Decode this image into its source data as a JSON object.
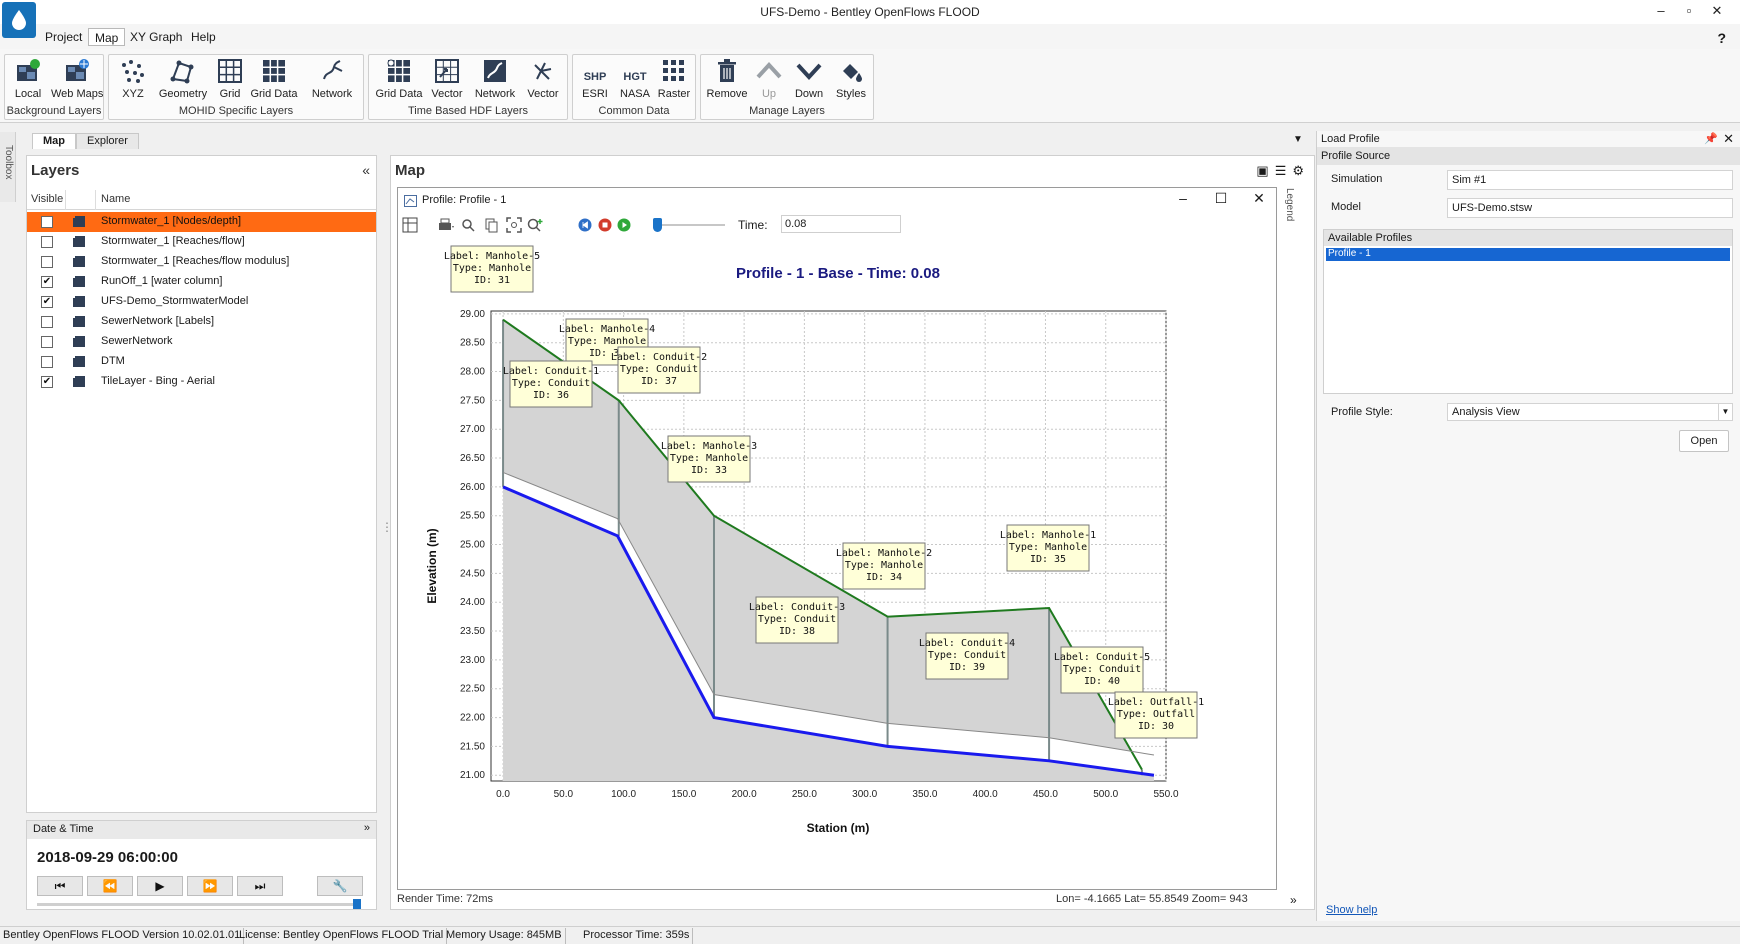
{
  "window": {
    "title": "UFS-Demo - Bentley OpenFlows FLOOD",
    "minimize": "–",
    "maximize": "▫",
    "close": "✕"
  },
  "menu": {
    "items": [
      "Project",
      "Map",
      "XY Graph",
      "Help"
    ],
    "help_icon": "?"
  },
  "ribbon": {
    "groups": [
      {
        "label": "Background Layers",
        "buttons": [
          {
            "label": "Local",
            "icon": "local-map-icon"
          },
          {
            "label": "Web Maps",
            "icon": "web-maps-icon"
          }
        ]
      },
      {
        "label": "MOHID Specific Layers",
        "buttons": [
          {
            "label": "XYZ",
            "icon": "xyz-points-icon"
          },
          {
            "label": "Geometry",
            "icon": "geometry-icon"
          },
          {
            "label": "Grid",
            "icon": "grid-icon"
          },
          {
            "label": "Grid Data",
            "icon": "grid-data-icon"
          },
          {
            "label": "Network",
            "icon": "network-icon"
          }
        ]
      },
      {
        "label": "Time Based HDF Layers",
        "buttons": [
          {
            "label": "Grid Data",
            "icon": "hdf-grid-data-icon"
          },
          {
            "label": "Vector",
            "icon": "vector-grid-icon"
          },
          {
            "label": "Network",
            "icon": "hdf-network-icon"
          },
          {
            "label": "Vector",
            "icon": "vector-arrows-icon"
          }
        ]
      },
      {
        "label": "Common Data",
        "buttons": [
          {
            "label": "ESRI",
            "icon": "esri-shp-icon",
            "glyph": "SHP"
          },
          {
            "label": "NASA",
            "icon": "nasa-hgt-icon",
            "glyph": "HGT"
          },
          {
            "label": "Raster",
            "icon": "raster-icon"
          }
        ]
      },
      {
        "label": "Manage Layers",
        "buttons": [
          {
            "label": "Remove",
            "icon": "trash-icon"
          },
          {
            "label": "Up",
            "icon": "up-arrow-icon"
          },
          {
            "label": "Down",
            "icon": "down-arrow-icon"
          },
          {
            "label": "Styles",
            "icon": "styles-icon"
          }
        ]
      }
    ]
  },
  "toolbox": {
    "label": "Toolbox"
  },
  "doc_tabs": [
    "Map",
    "Explorer"
  ],
  "layers": {
    "title": "Layers",
    "collapse": "«",
    "columns": {
      "visible": "Visible",
      "name": "Name"
    },
    "rows": [
      {
        "name": "Stormwater_1 [Nodes/depth]",
        "checked": false,
        "selected": true
      },
      {
        "name": "Stormwater_1 [Reaches/flow]",
        "checked": false,
        "selected": false
      },
      {
        "name": "Stormwater_1 [Reaches/flow modulus]",
        "checked": false,
        "selected": false
      },
      {
        "name": "RunOff_1 [water column]",
        "checked": true,
        "selected": false
      },
      {
        "name": "UFS-Demo_StormwaterModel",
        "checked": true,
        "selected": false
      },
      {
        "name": "SewerNetwork [Labels]",
        "checked": false,
        "selected": false
      },
      {
        "name": "SewerNetwork",
        "checked": false,
        "selected": false
      },
      {
        "name": "DTM",
        "checked": false,
        "selected": false
      },
      {
        "name": "TileLayer - Bing - Aerial",
        "checked": true,
        "selected": false
      }
    ]
  },
  "datetime": {
    "title": "Date & Time",
    "collapse": "»",
    "value": "2018-09-29 06:00:00",
    "controls": [
      "⏮",
      "⏪",
      "▶",
      "⏩",
      "⏭",
      "🔧"
    ],
    "position": 1.0
  },
  "map": {
    "title": "Map",
    "render_time": "Render Time: 72ms",
    "coords": "Lon= -4.1665   Lat= 55.8549   Zoom= 943",
    "legend": "Legend",
    "collapse": "»"
  },
  "profile_window": {
    "title": "Profile: Profile - 1",
    "time_label": "Time:",
    "time_value": "0.08",
    "time_position": 0.0
  },
  "chart_data": {
    "type": "line",
    "title": "Profile - 1 - Base - Time: 0.08",
    "xlabel": "Station (m)",
    "ylabel": "Elevation (m)",
    "xlim": [
      -10,
      550
    ],
    "ylim": [
      20.9,
      29.05
    ],
    "xticks": [
      "0.0",
      "50.0",
      "100.0",
      "150.0",
      "200.0",
      "250.0",
      "300.0",
      "350.0",
      "400.0",
      "450.0",
      "500.0",
      "550.0"
    ],
    "yticks": [
      "21.00",
      "21.50",
      "22.00",
      "22.50",
      "23.00",
      "23.50",
      "24.00",
      "24.50",
      "25.00",
      "25.50",
      "26.00",
      "26.50",
      "27.00",
      "27.50",
      "28.00",
      "28.50",
      "29.00"
    ],
    "grid": true,
    "series": [
      {
        "role": "ground",
        "color": "#1f7a1f",
        "x": [
          0,
          96,
          175,
          319,
          453,
          530
        ],
        "y": [
          28.9,
          27.5,
          25.5,
          23.75,
          23.9,
          21.1
        ]
      },
      {
        "role": "crown",
        "color": "#888888",
        "x": [
          0,
          95,
          175,
          319,
          453,
          540
        ],
        "y": [
          26.25,
          25.45,
          22.4,
          21.9,
          21.65,
          21.35
        ]
      },
      {
        "role": "invert",
        "color": "#1a1aee",
        "x": [
          0,
          95,
          175,
          319,
          453,
          540
        ],
        "y": [
          26.0,
          25.15,
          22.0,
          21.5,
          21.25,
          21.0
        ]
      }
    ],
    "annotations": [
      {
        "label": "Label: Manhole-5",
        "type": "Type: Manhole",
        "id": "ID: 31",
        "x": 0
      },
      {
        "label": "Label: Manhole-4",
        "type": "Type: Manhole",
        "id": "ID: 32",
        "x": 95
      },
      {
        "label": "Label: Conduit-2",
        "type": "Type: Conduit",
        "id": "ID: 37",
        "x": 135
      },
      {
        "label": "Label: Conduit-1",
        "type": "Type: Conduit",
        "id": "ID: 36",
        "x": 47
      },
      {
        "label": "Label: Manhole-3",
        "type": "Type: Manhole",
        "id": "ID: 33",
        "x": 175
      },
      {
        "label": "Label: Manhole-2",
        "type": "Type: Manhole",
        "id": "ID: 34",
        "x": 319
      },
      {
        "label": "Label: Manhole-1",
        "type": "Type: Manhole",
        "id": "ID: 35",
        "x": 453
      },
      {
        "label": "Label: Conduit-3",
        "type": "Type: Conduit",
        "id": "ID: 38",
        "x": 247
      },
      {
        "label": "Label: Conduit-4",
        "type": "Type: Conduit",
        "id": "ID: 39",
        "x": 386
      },
      {
        "label": "Label: Conduit-5",
        "type": "Type: Conduit",
        "id": "ID: 40",
        "x": 496
      },
      {
        "label": "Label: Outfall-1",
        "type": "Type: Outfall",
        "id": "ID: 30",
        "x": 540
      }
    ]
  },
  "load_profile": {
    "title": "Load Profile",
    "pin": "📌",
    "close": "✕",
    "section": "Profile Source",
    "simulation_label": "Simulation",
    "simulation_value": "Sim #1",
    "model_label": "Model",
    "model_value": "UFS-Demo.stsw",
    "available_label": "Available Profiles",
    "profiles": [
      "Profile - 1"
    ],
    "style_label": "Profile Style:",
    "style_value": "Analysis View",
    "open_label": "Open",
    "show_help": "Show help"
  },
  "status": {
    "version": "Bentley OpenFlows FLOOD Version 10.02.01.01",
    "license": "License: Bentley OpenFlows FLOOD Trial",
    "memory": "Memory Usage: 845MB",
    "processor": "Processor Time: 359s"
  },
  "colors": {
    "selected_row": "#ff6a13",
    "accent": "#1671b8",
    "list_selection": "#1666d2"
  }
}
